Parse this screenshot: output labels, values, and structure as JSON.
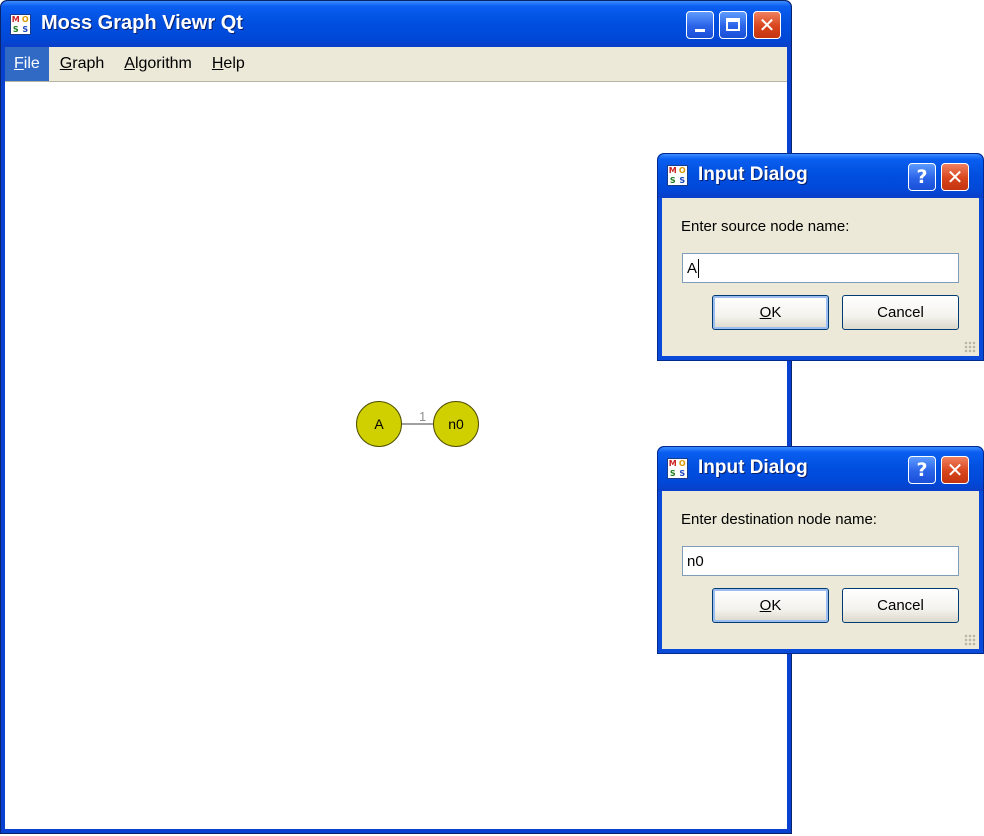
{
  "main_window": {
    "title": "Moss Graph Viewr Qt",
    "icon": "moss-app-icon",
    "icon_letters": [
      "M",
      "O",
      "S",
      "S"
    ],
    "menu": [
      {
        "label": "File",
        "mnemonic": "F",
        "rest": "ile"
      },
      {
        "label": "Graph",
        "mnemonic": "G",
        "rest": "raph"
      },
      {
        "label": "Algorithm",
        "mnemonic": "A",
        "rest": "lgorithm"
      },
      {
        "label": "Help",
        "mnemonic": "H",
        "rest": "elp"
      }
    ]
  },
  "graph": {
    "nodes": [
      {
        "label": "A",
        "color": "#d0d000"
      },
      {
        "label": "n0",
        "color": "#d0d000"
      }
    ],
    "edges": [
      {
        "from": "A",
        "to": "n0",
        "weight": "1"
      }
    ]
  },
  "dialogs": [
    {
      "title": "Input Dialog",
      "prompt": "Enter source node name:",
      "value": "A",
      "ok_mnemonic": "O",
      "ok_rest": "K",
      "cancel_label": "Cancel"
    },
    {
      "title": "Input Dialog",
      "prompt": "Enter destination node name:",
      "value": "n0",
      "ok_mnemonic": "O",
      "ok_rest": "K",
      "cancel_label": "Cancel"
    }
  ],
  "colors": {
    "titlebar": "#0150e0",
    "menu_active": "#316ac5",
    "node_fill": "#d0d000"
  }
}
